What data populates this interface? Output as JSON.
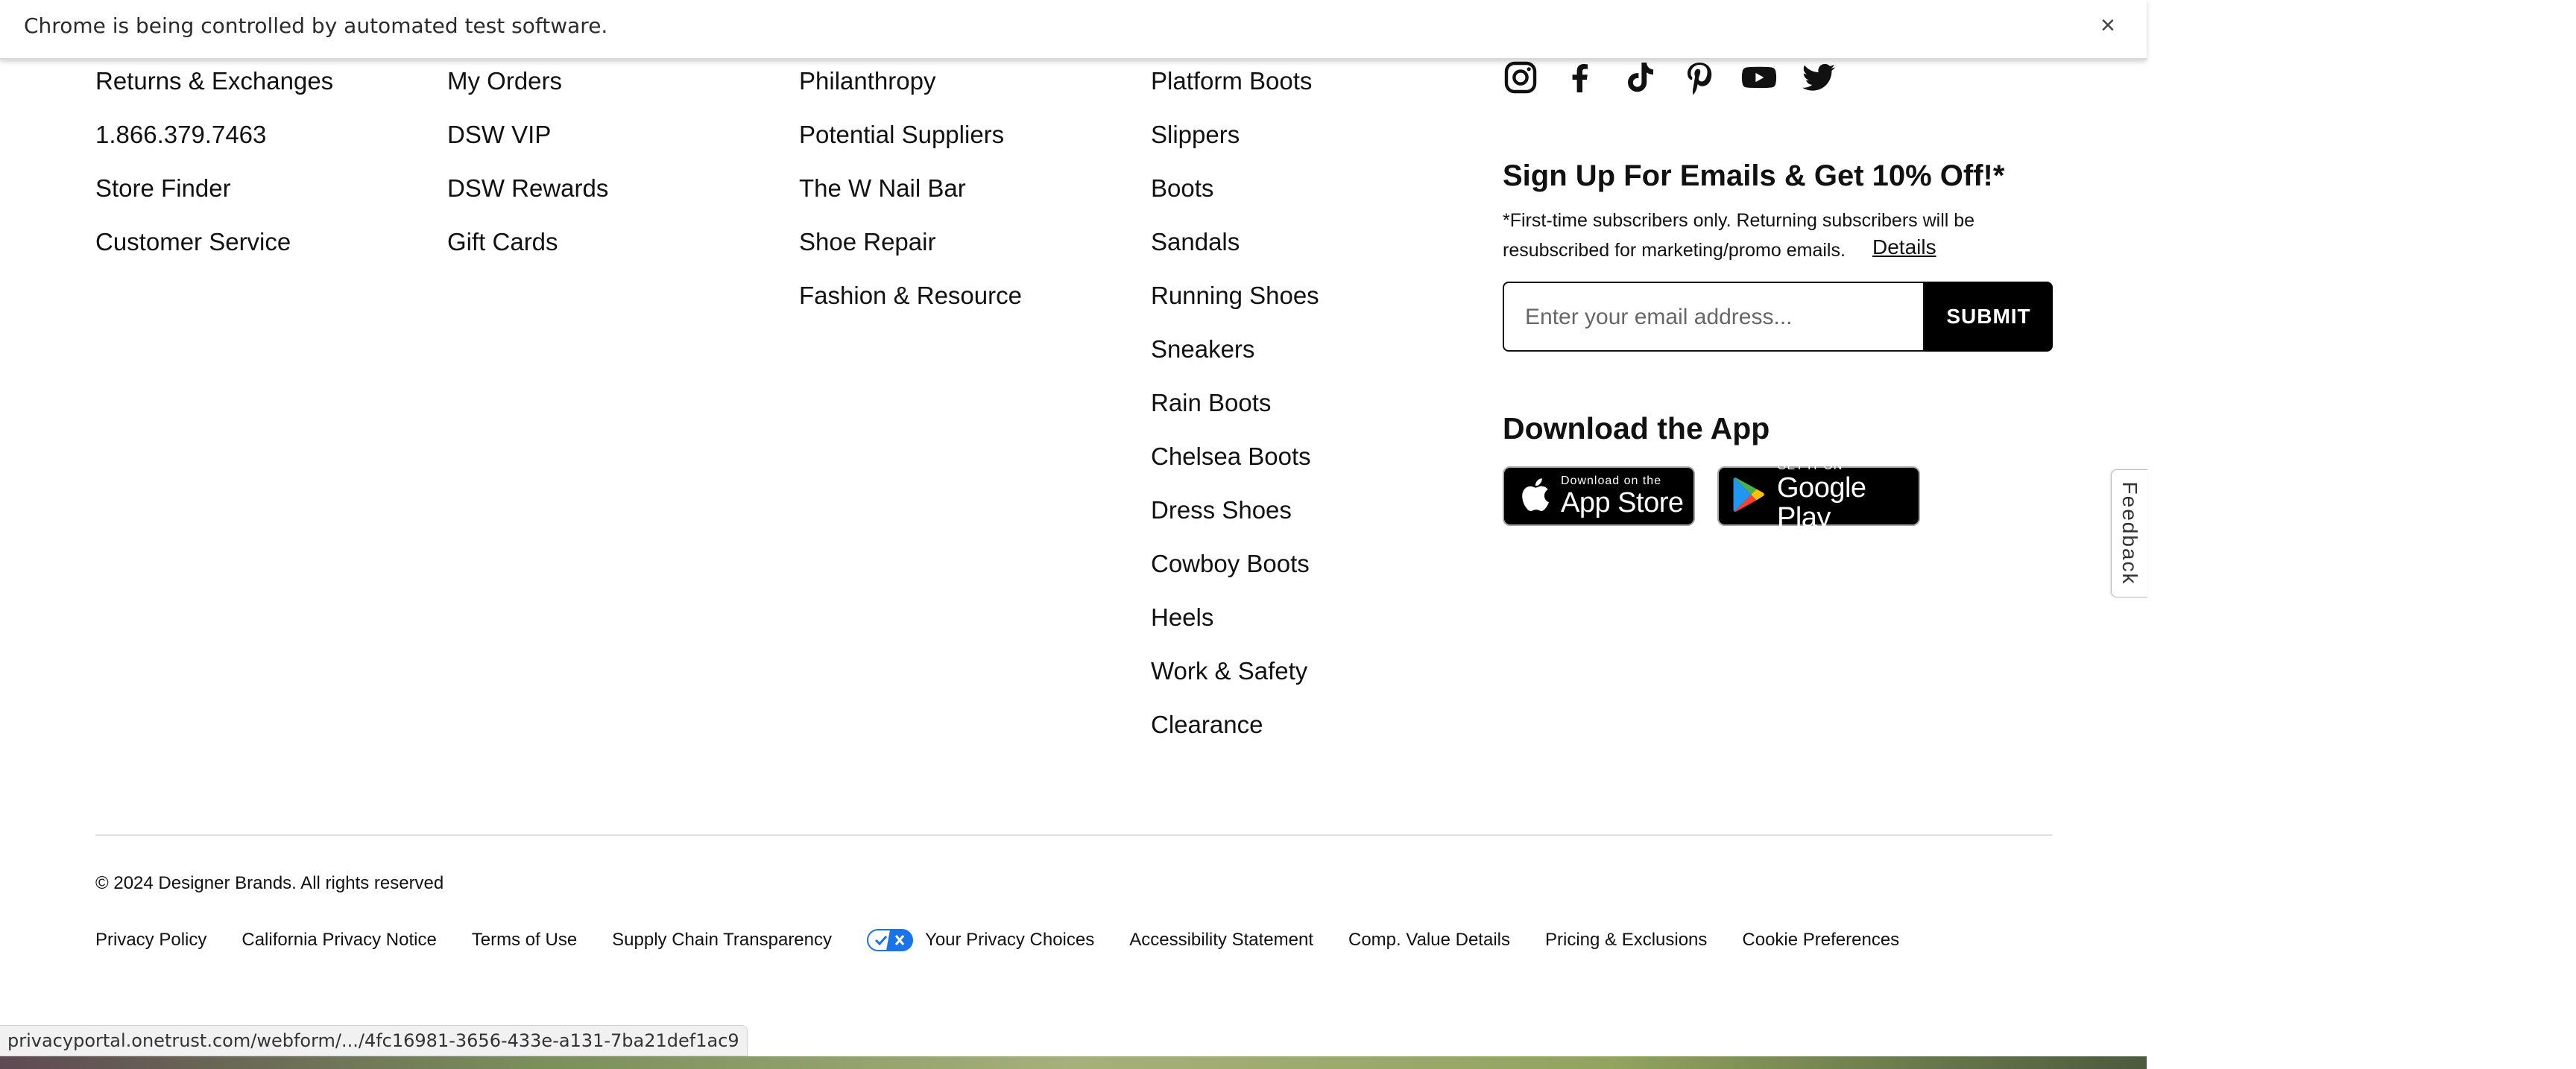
{
  "infobar": {
    "message": "Chrome is being controlled by automated test software.",
    "close_symbol": "×"
  },
  "columns": {
    "col1": [
      "Returns & Exchanges",
      "1.866.379.7463",
      "Store Finder",
      "Customer Service"
    ],
    "col2": [
      "My Orders",
      "DSW VIP",
      "DSW Rewards",
      "Gift Cards"
    ],
    "col3": [
      "Philanthropy",
      "Potential Suppliers",
      "The W Nail Bar",
      "Shoe Repair",
      "Fashion & Resource"
    ],
    "col4": [
      "Platform Boots",
      "Slippers",
      "Boots",
      "Sandals",
      "Running Shoes",
      "Sneakers",
      "Rain Boots",
      "Chelsea Boots",
      "Dress Shoes",
      "Cowboy Boots",
      "Heels",
      "Work & Safety",
      "Clearance"
    ]
  },
  "social_icons": [
    "instagram-icon",
    "facebook-icon",
    "tiktok-icon",
    "pinterest-icon",
    "youtube-icon",
    "twitter-icon"
  ],
  "signup": {
    "heading": "Sign Up For Emails & Get 10% Off!*",
    "note": "*First-time subscribers only. Returning subscribers will be resubscribed for marketing/promo emails.",
    "details_label": "Details",
    "email_placeholder": "Enter your email address...",
    "submit_label": "SUBMIT"
  },
  "app": {
    "heading": "Download the App",
    "appstore_small": "Download on the",
    "appstore_big": "App Store",
    "googleplay_small": "GET IT ON",
    "googleplay_big": "Google Play"
  },
  "feedback_label": "Feedback",
  "footer": {
    "copyright": "© 2024 Designer Brands. All rights reserved",
    "links": {
      "privacy_policy": "Privacy Policy",
      "california_privacy": "California Privacy Notice",
      "terms": "Terms of Use",
      "supply_chain": "Supply Chain Transparency",
      "privacy_choices": "Your Privacy Choices",
      "accessibility": "Accessibility Statement",
      "comp_value": "Comp. Value Details",
      "pricing": "Pricing & Exclusions",
      "cookie_prefs": "Cookie Preferences"
    }
  },
  "status_url": "privacyportal.onetrust.com/webform/.../4fc16981-3656-433e-a131-7ba21def1ac9",
  "colors": {
    "text": "#111111",
    "button_bg": "#000000",
    "privacy_toggle": "#1a73e8"
  }
}
